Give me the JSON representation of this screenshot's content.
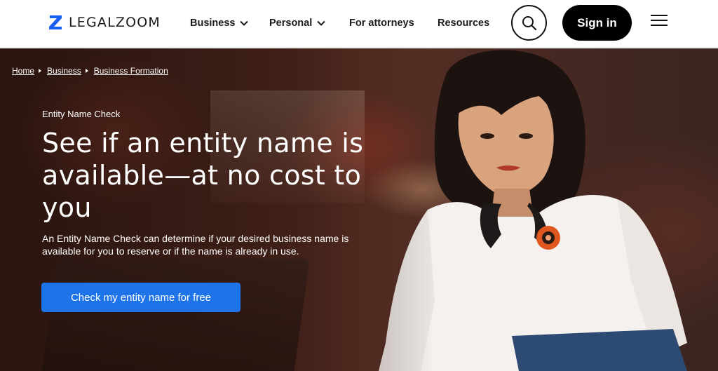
{
  "header": {
    "logo_text": "LEGALZOOM",
    "nav": [
      {
        "label": "Business",
        "has_dropdown": true
      },
      {
        "label": "Personal",
        "has_dropdown": true
      },
      {
        "label": "For attorneys",
        "has_dropdown": false
      },
      {
        "label": "Resources",
        "has_dropdown": false
      }
    ],
    "search_icon": "search-icon",
    "signin_label": "Sign in",
    "menu_icon": "hamburger-menu-icon"
  },
  "breadcrumb": [
    "Home",
    "Business",
    "Business Formation"
  ],
  "hero": {
    "eyebrow": "Entity Name Check",
    "headline": "See if an entity name is available—at no cost to you",
    "subtext": "An Entity Name Check can determine if your desired business name is available for you to reserve or if the name is already in use.",
    "cta_label": "Check my entity name for free"
  },
  "colors": {
    "brand_blue": "#1e73e8",
    "logo_blue": "#1b5ef0",
    "header_bg": "#ffffff",
    "signin_bg": "#000000"
  }
}
